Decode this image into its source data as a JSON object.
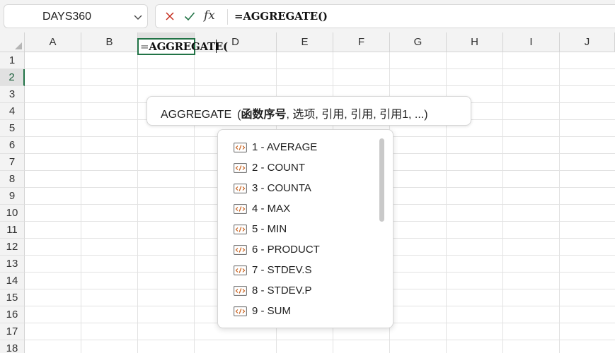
{
  "namebox": {
    "value": "DAYS360"
  },
  "formula_bar": {
    "fx": "fx",
    "formula": "=AGGREGATE()"
  },
  "columns": [
    "A",
    "B",
    "C",
    "D",
    "E",
    "F",
    "G",
    "H",
    "I",
    "J"
  ],
  "rows": [
    "1",
    "2",
    "3",
    "4",
    "5",
    "6",
    "7",
    "8",
    "9",
    "10",
    "11",
    "12",
    "13",
    "14",
    "15",
    "16",
    "17",
    "18"
  ],
  "active_cell": {
    "column": "C",
    "row": "2",
    "eq": "=",
    "text": "AGGREGATE("
  },
  "tooltip": {
    "function_name": "AGGREGATE",
    "open_paren": "(",
    "current_arg": "函数序号",
    "rest_args": ", 选项, 引用, 引用, 引用1, ...)"
  },
  "dropdown": {
    "items": [
      {
        "label": "1 - AVERAGE"
      },
      {
        "label": "2 - COUNT"
      },
      {
        "label": "3 - COUNTA"
      },
      {
        "label": "4 - MAX"
      },
      {
        "label": "5 - MIN"
      },
      {
        "label": "6 - PRODUCT"
      },
      {
        "label": "7 - STDEV.S"
      },
      {
        "label": "8 - STDEV.P"
      },
      {
        "label": "9 - SUM"
      }
    ]
  },
  "colors": {
    "accent": "#217346",
    "cancel": "#c42b1c",
    "confirm": "#217346",
    "icon_orange": "#c75f1b"
  }
}
